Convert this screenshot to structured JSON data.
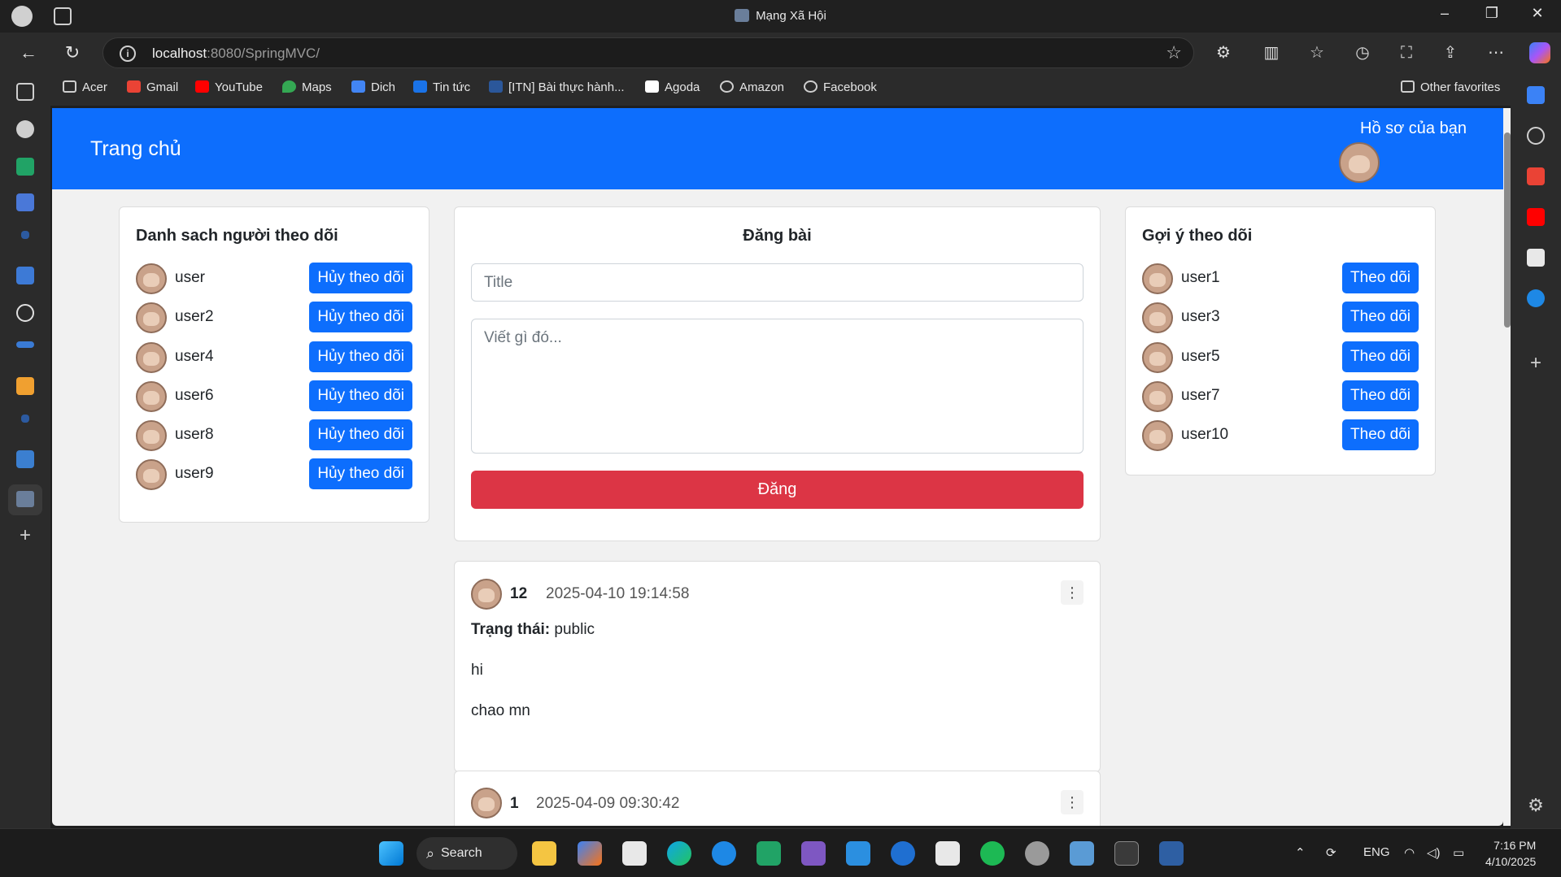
{
  "browser": {
    "window_title": "Mạng Xã Hội",
    "url_host": "localhost",
    "url_rest": ":8080/SpringMVC/",
    "bookmarks": [
      {
        "label": "Acer",
        "icon": "folder-icon",
        "color": "#cfcfcf"
      },
      {
        "label": "Gmail",
        "icon": "gmail-icon",
        "color": "#ea4335"
      },
      {
        "label": "YouTube",
        "icon": "youtube-icon",
        "color": "#ff0000"
      },
      {
        "label": "Maps",
        "icon": "maps-icon",
        "color": "#34a853"
      },
      {
        "label": "Dich",
        "icon": "translate-icon",
        "color": "#4285f4"
      },
      {
        "label": "Tin tức",
        "icon": "news-icon",
        "color": "#1a73e8"
      },
      {
        "label": "[ITN] Bài thực hành...",
        "icon": "word-icon",
        "color": "#2b579a"
      },
      {
        "label": "Agoda",
        "icon": "agoda-icon",
        "color": "#ffffff"
      },
      {
        "label": "Amazon",
        "icon": "globe-icon",
        "color": "#cfcfcf"
      },
      {
        "label": "Facebook",
        "icon": "globe-icon",
        "color": "#cfcfcf"
      }
    ],
    "other_favorites": "Other favorites"
  },
  "app": {
    "brand": "Trang chủ",
    "profile_link": "Hồ sơ của bạn",
    "primary_color": "#0d6efd",
    "danger_color": "#dc3545"
  },
  "following": {
    "title": "Danh sach người theo dõi",
    "button_label": "Hủy theo dõi",
    "users": [
      "user",
      "user2",
      "user4",
      "user6",
      "user8",
      "user9"
    ]
  },
  "composer": {
    "title": "Đăng bài",
    "title_placeholder": "Title",
    "body_placeholder": "Viết gì đó...",
    "submit_label": "Đăng"
  },
  "suggestions": {
    "title": "Gợi ý theo dõi",
    "button_label": "Theo dõi",
    "users": [
      "user1",
      "user3",
      "user5",
      "user7",
      "user10"
    ]
  },
  "posts": [
    {
      "author": "12",
      "timestamp": "2025-04-10 19:14:58",
      "status_label": "Trạng thái:",
      "status": "public",
      "title": "hi",
      "body": "chao mn"
    },
    {
      "author": "1",
      "timestamp": "2025-04-09 09:30:42"
    }
  ],
  "taskbar": {
    "search_label": "Search",
    "language": "ENG",
    "time": "7:16 PM",
    "date": "4/10/2025"
  }
}
